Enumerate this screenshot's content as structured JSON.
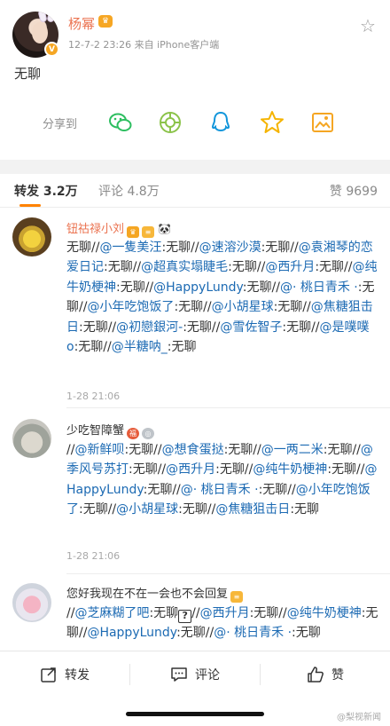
{
  "post": {
    "author": "杨幂",
    "meta": "12-7-2 23:26  来自 iPhone客户端",
    "text": "无聊",
    "share_label": "分享到",
    "share_targets": [
      "wechat-icon",
      "moments-icon",
      "qq-icon",
      "qzone-icon",
      "save-image-icon"
    ]
  },
  "tabs": {
    "repost": "转发 3.2万",
    "comment": "评论 4.8万",
    "like": "赞 9699"
  },
  "reposts": [
    {
      "user": "钮祜禄小刘",
      "user_color": "#eb7350",
      "time": "1-28 21:06",
      "segments": [
        {
          "t": "无聊//"
        },
        {
          "t": "@一隻美汪",
          "at": true
        },
        {
          "t": ":无聊//"
        },
        {
          "t": "@速溶沙漠",
          "at": true
        },
        {
          "t": ":无聊//"
        },
        {
          "t": "@袁湘琴的恋爱日记",
          "at": true
        },
        {
          "t": ":无聊//"
        },
        {
          "t": "@超真实塌睫毛",
          "at": true
        },
        {
          "t": ":无聊//"
        },
        {
          "t": "@西升月",
          "at": true
        },
        {
          "t": ":无聊//"
        },
        {
          "t": "@纯牛奶梗神",
          "at": true
        },
        {
          "t": ":无聊//"
        },
        {
          "t": "@HappyLundy",
          "at": true
        },
        {
          "t": ":无聊//"
        },
        {
          "t": "@· 桃日青禾 ·",
          "at": true
        },
        {
          "t": ":无聊//"
        },
        {
          "t": "@小年吃饱饭了",
          "at": true
        },
        {
          "t": ":无聊//"
        },
        {
          "t": "@小胡星球",
          "at": true
        },
        {
          "t": ":无聊//"
        },
        {
          "t": "@焦糖狙击日",
          "at": true
        },
        {
          "t": ":无聊//"
        },
        {
          "t": "@初戀銀河-",
          "at": true
        },
        {
          "t": ":无聊//"
        },
        {
          "t": "@雪佐智子",
          "at": true
        },
        {
          "t": ":无聊//"
        },
        {
          "t": "@是噗噗o",
          "at": true
        },
        {
          "t": ":无聊//"
        },
        {
          "t": "@半糖呐_",
          "at": true
        },
        {
          "t": ":无聊"
        }
      ]
    },
    {
      "user": "少吃智障蟹",
      "user_color": "#333333",
      "time": "1-28 21:06",
      "segments": [
        {
          "t": "//"
        },
        {
          "t": "@新鲜呗",
          "at": true
        },
        {
          "t": ":无聊//"
        },
        {
          "t": "@想食蛋挞",
          "at": true
        },
        {
          "t": ":无聊//"
        },
        {
          "t": "@一两二米",
          "at": true
        },
        {
          "t": ":无聊//"
        },
        {
          "t": "@季风号苏打",
          "at": true
        },
        {
          "t": ":无聊//"
        },
        {
          "t": "@西升月",
          "at": true
        },
        {
          "t": ":无聊//"
        },
        {
          "t": "@纯牛奶梗神",
          "at": true
        },
        {
          "t": ":无聊//"
        },
        {
          "t": "@HappyLundy",
          "at": true
        },
        {
          "t": ":无聊//"
        },
        {
          "t": "@· 桃日青禾 ·",
          "at": true
        },
        {
          "t": ":无聊//"
        },
        {
          "t": "@小年吃饱饭了",
          "at": true
        },
        {
          "t": ":无聊//"
        },
        {
          "t": "@小胡星球",
          "at": true
        },
        {
          "t": ":无聊//"
        },
        {
          "t": "@焦糖狙击日",
          "at": true
        },
        {
          "t": ":无聊"
        }
      ]
    },
    {
      "user": "您好我现在不在一会也不会回复",
      "user_color": "#333333",
      "time": "",
      "segments": [
        {
          "t": "//"
        },
        {
          "t": "@芝麻糊了吧",
          "at": true
        },
        {
          "t": ":无聊"
        },
        {
          "t": "?",
          "box": true
        },
        {
          "t": "//"
        },
        {
          "t": "@西升月",
          "at": true
        },
        {
          "t": ":无聊//"
        },
        {
          "t": "@纯牛奶梗神",
          "at": true
        },
        {
          "t": ":无聊//"
        },
        {
          "t": "@HappyLundy",
          "at": true
        },
        {
          "t": ":无聊//"
        },
        {
          "t": "@· 桃日青禾 ·",
          "at": true
        },
        {
          "t": ":无聊"
        }
      ]
    }
  ],
  "bottom_bar": {
    "repost": "转发",
    "comment": "评论",
    "like": "赞"
  },
  "watermark": "@梨视新闻",
  "colors": {
    "accent": "#ff8200",
    "name": "#eb7350",
    "mention": "#1c6ab3"
  }
}
